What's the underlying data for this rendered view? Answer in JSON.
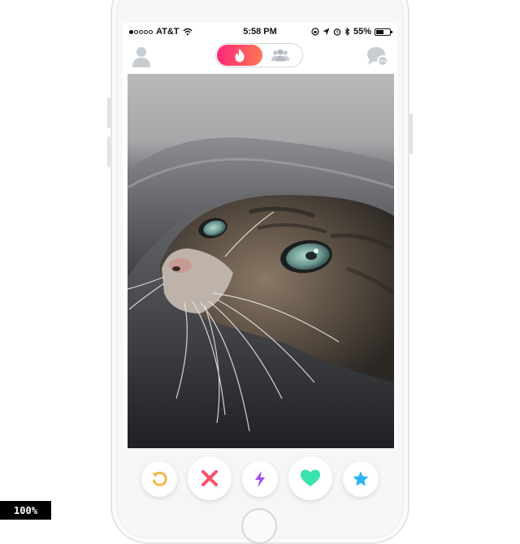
{
  "status_bar": {
    "carrier": "AT&T",
    "time": "5:58 PM",
    "battery_percent_label": "55%",
    "battery_level": 0.55,
    "signal_bars_filled": 1,
    "signal_bars_total": 5,
    "icons": [
      "wifi-icon",
      "screen-lock-icon",
      "location-icon",
      "alarm-icon",
      "bluetooth-icon",
      "battery-icon"
    ]
  },
  "nav": {
    "left_icon": "profile-icon",
    "right_icon": "messages-icon",
    "toggle": {
      "active": "flame-icon",
      "inactive": "group-icon"
    }
  },
  "card": {
    "image": "cat-photo",
    "subject": "tabby cat under grey blanket"
  },
  "actions": [
    {
      "name": "rewind-button",
      "icon": "rewind-icon",
      "color": "#f5b748"
    },
    {
      "name": "nope-button",
      "icon": "x-icon",
      "color": "#fd5068"
    },
    {
      "name": "boost-button",
      "icon": "lightning-icon",
      "color": "#a24cf2"
    },
    {
      "name": "like-button",
      "icon": "heart-icon",
      "color": "#3ae2ad"
    },
    {
      "name": "super-like-button",
      "icon": "star-icon",
      "color": "#2db4f5"
    }
  ],
  "colors": {
    "brand_gradient_start": "#fd267d",
    "brand_gradient_end": "#ff7854",
    "inactive_icon": "#c8cdd2"
  },
  "overlay": {
    "zoom": "100%"
  }
}
